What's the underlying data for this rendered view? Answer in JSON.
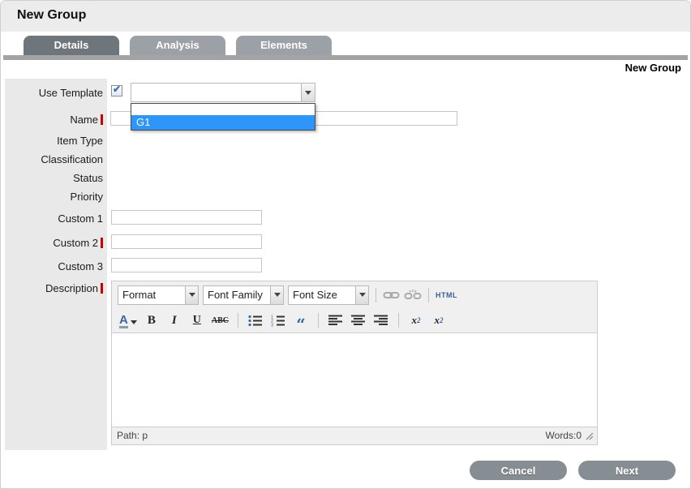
{
  "window": {
    "title": "New Group"
  },
  "tabs": [
    {
      "label": "Details",
      "active": true
    },
    {
      "label": "Analysis",
      "active": false
    },
    {
      "label": "Elements",
      "active": false
    }
  ],
  "section_title": "New Group",
  "form": {
    "fields": [
      {
        "label": "Use Template",
        "required": false,
        "checked": true
      },
      {
        "label": "Name",
        "required": true,
        "value": ""
      },
      {
        "label": "Item Type",
        "required": false
      },
      {
        "label": "Classification",
        "required": false
      },
      {
        "label": "Status",
        "required": false
      },
      {
        "label": "Priority",
        "required": false
      },
      {
        "label": "Custom 1",
        "required": false,
        "value": ""
      },
      {
        "label": "Custom 2",
        "required": true,
        "value": ""
      },
      {
        "label": "Custom 3",
        "required": false,
        "value": ""
      },
      {
        "label": "Description",
        "required": true
      }
    ]
  },
  "template_dropdown": {
    "selected": "",
    "options": [
      "",
      "G1"
    ],
    "highlighted": "G1"
  },
  "editor": {
    "format": "Format",
    "font_family": "Font Family",
    "font_size": "Font Size",
    "html_label": "HTML",
    "forecolor_letter": "A",
    "bold": "B",
    "italic": "I",
    "underline": "U",
    "strikethrough": "ABC",
    "blockquote_glyph": "“",
    "subscript_base": "x",
    "subscript_mark": "2",
    "superscript_base": "x",
    "superscript_mark": "2",
    "path_status": "Path: p",
    "word_count": "Words:0"
  },
  "actions": {
    "cancel_label": "Cancel",
    "next_label": "Next"
  },
  "colors": {
    "highlight_blue": "#2e95fa",
    "required_red": "#cc0000",
    "tab_active": "#6e757b",
    "tab_inactive": "#9ba1a6",
    "button_gray": "#868d93",
    "header_gray": "#ececec",
    "label_col_gray": "#e9e9e9"
  }
}
